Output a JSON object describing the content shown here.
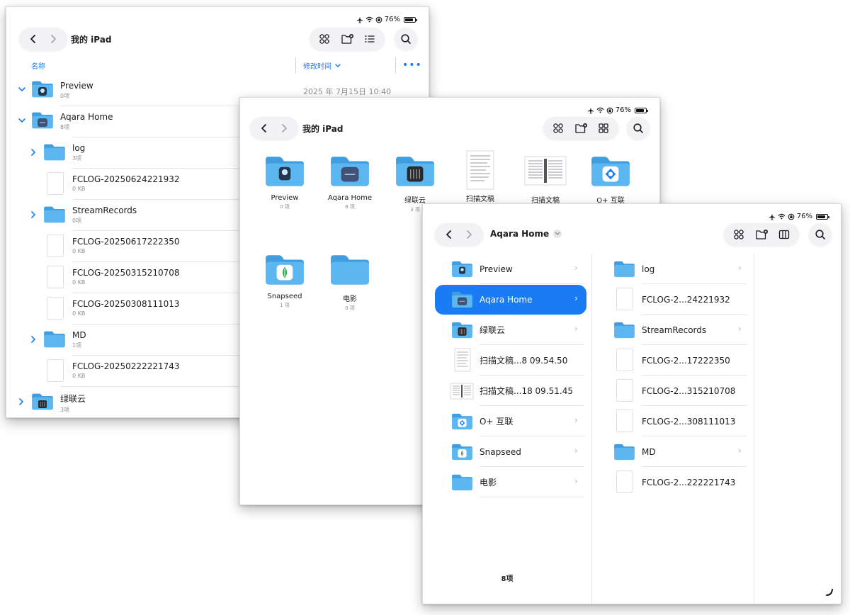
{
  "status": {
    "battery": "76%"
  },
  "list_view": {
    "title": "我的 iPad",
    "col_name": "名称",
    "col_date": "修改时间",
    "rows": [
      {
        "name": "Preview",
        "sub": "0项",
        "date": "2025 年 7月15日 10:40"
      },
      {
        "name": "Aqara Home",
        "sub": "8项"
      },
      {
        "name": "log",
        "sub": "3项"
      },
      {
        "name": "FCLOG-20250624221932",
        "sub": "0 KB"
      },
      {
        "name": "StreamRecords",
        "sub": "0项"
      },
      {
        "name": "FCLOG-20250617222350",
        "sub": "0 KB"
      },
      {
        "name": "FCLOG-20250315210708",
        "sub": "0 KB"
      },
      {
        "name": "FCLOG-20250308111013",
        "sub": "0 KB"
      },
      {
        "name": "MD",
        "sub": "1项"
      },
      {
        "name": "FCLOG-20250222221743",
        "sub": "0 KB"
      },
      {
        "name": "绿联云",
        "sub": "3项"
      }
    ]
  },
  "grid_view": {
    "title": "我的 iPad",
    "items": [
      {
        "name": "Preview",
        "sub": "0 项"
      },
      {
        "name": "Aqara Home",
        "sub": "8 项"
      },
      {
        "name": "绿联云",
        "sub": "3 项"
      },
      {
        "name": "扫描文稿",
        "sub": ""
      },
      {
        "name": "扫描文稿",
        "sub": ""
      },
      {
        "name": "O+ 互联",
        "sub": ""
      },
      {
        "name": "Snapseed",
        "sub": "1 项"
      },
      {
        "name": "电影",
        "sub": "0 项"
      }
    ]
  },
  "column_view": {
    "title": "Aqara Home",
    "left": [
      {
        "name": "Preview"
      },
      {
        "name": "Aqara Home"
      },
      {
        "name": "绿联云"
      },
      {
        "name": "扫描文稿...8 09.54.50"
      },
      {
        "name": "扫描文稿...18 09.51.45"
      },
      {
        "name": "O+ 互联"
      },
      {
        "name": "Snapseed"
      },
      {
        "name": "电影"
      }
    ],
    "right": [
      {
        "name": "log"
      },
      {
        "name": "FCLOG-2...24221932"
      },
      {
        "name": "StreamRecords"
      },
      {
        "name": "FCLOG-2...17222350"
      },
      {
        "name": "FCLOG-2...315210708"
      },
      {
        "name": "FCLOG-2...308111013"
      },
      {
        "name": "MD"
      },
      {
        "name": "FCLOG-2...222221743"
      }
    ],
    "footer": "8项"
  },
  "colors": {
    "accent": "#1a7cf5",
    "folder": "#5cb6f0",
    "folder_tab": "#3f9de0"
  }
}
